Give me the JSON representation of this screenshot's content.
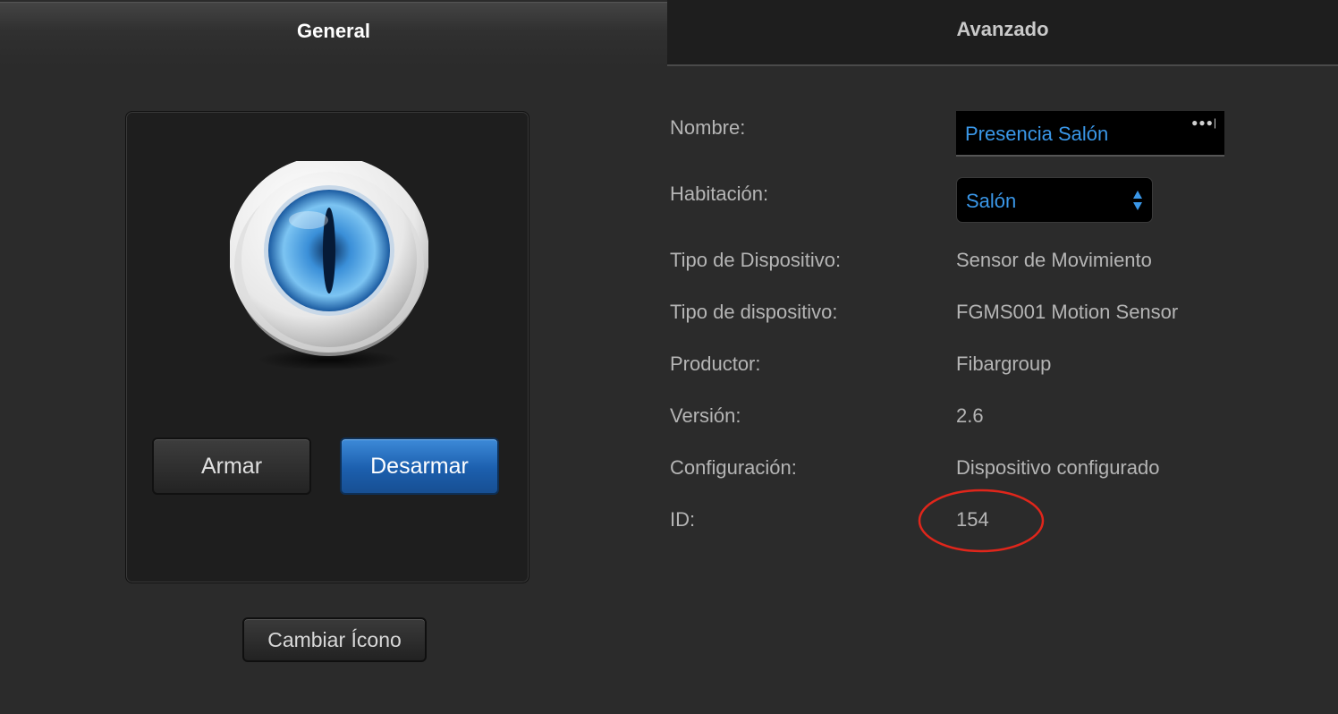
{
  "tabs": {
    "general": "General",
    "advanced": "Avanzado"
  },
  "icon_panel": {
    "icon": "motion-sensor-eye-icon",
    "arm_label": "Armar",
    "disarm_label": "Desarmar"
  },
  "change_icon_label": "Cambiar Ícono",
  "fields": {
    "name": {
      "label": "Nombre:",
      "value": "Presencia Salón"
    },
    "room": {
      "label": "Habitación:",
      "value": "Salón"
    },
    "device_type": {
      "label": "Tipo de Dispositivo:",
      "value": "Sensor de Movimiento"
    },
    "device_model": {
      "label": "Tipo de dispositivo:",
      "value": "FGMS001 Motion Sensor"
    },
    "producer": {
      "label": "Productor:",
      "value": "Fibargroup"
    },
    "version": {
      "label": "Versión:",
      "value": "2.6"
    },
    "configuration": {
      "label": "Configuración:",
      "value": "Dispositivo configurado"
    },
    "id": {
      "label": "ID:",
      "value": "154"
    }
  },
  "colors": {
    "accent_blue": "#3a97e8",
    "button_blue": "#1c5fae",
    "annotation_red": "#e0261b",
    "background": "#2b2b2b"
  }
}
